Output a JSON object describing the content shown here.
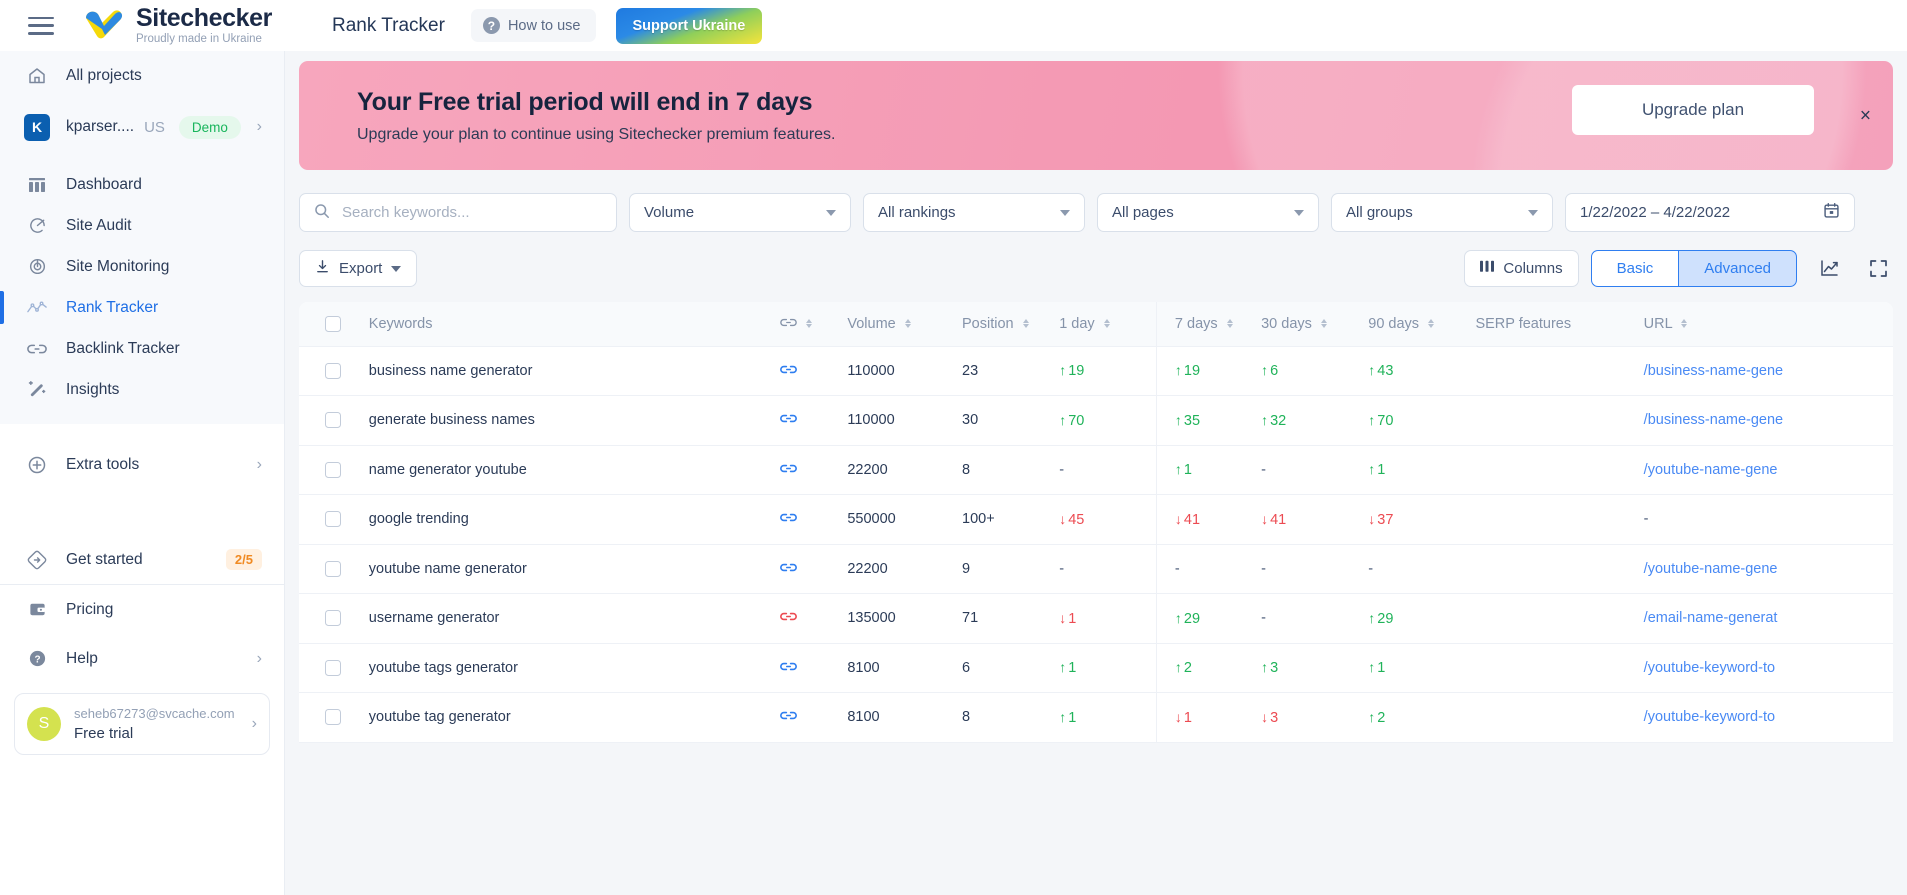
{
  "topbar": {
    "menu_icon": "hamburger-icon",
    "brand_name": "Sitechecker",
    "brand_tagline": "Proudly made in Ukraine",
    "page_title": "Rank Tracker",
    "how_to_use": "How to use",
    "support_button": "Support Ukraine"
  },
  "sidebar": {
    "all_projects": "All projects",
    "project": {
      "initial": "K",
      "name": "kparser....",
      "country": "US",
      "badge": "Demo"
    },
    "nav": [
      {
        "label": "Dashboard",
        "icon": "dashboard-icon",
        "active": false
      },
      {
        "label": "Site Audit",
        "icon": "gauge-icon",
        "active": false
      },
      {
        "label": "Site Monitoring",
        "icon": "radar-icon",
        "active": false
      },
      {
        "label": "Rank Tracker",
        "icon": "trend-icon",
        "active": true
      },
      {
        "label": "Backlink Tracker",
        "icon": "link-icon",
        "active": false
      },
      {
        "label": "Insights",
        "icon": "magic-wand-icon",
        "active": false
      }
    ],
    "extra_tools": "Extra tools",
    "get_started": {
      "label": "Get started",
      "progress": "2/5"
    },
    "pricing": "Pricing",
    "help": "Help",
    "user": {
      "avatar_letter": "S",
      "email": "seheb67273@svcache.com",
      "plan": "Free trial"
    }
  },
  "banner": {
    "title": "Your Free trial period will end in 7 days",
    "subtitle": "Upgrade your plan to continue using Sitechecker premium features.",
    "button": "Upgrade plan",
    "close": "×",
    "bg_color": "#f49ab4"
  },
  "filters": {
    "search_placeholder": "Search keywords...",
    "search_value": "",
    "volume": "Volume",
    "rankings": "All rankings",
    "pages": "All pages",
    "groups": "All groups",
    "date_range": "1/22/2022 – 4/22/2022"
  },
  "toolbar": {
    "export": "Export",
    "columns": "Columns",
    "basic": "Basic",
    "advanced": "Advanced",
    "active_view": "Advanced",
    "chart_icon": "line-chart-icon",
    "fullscreen_icon": "fullscreen-icon"
  },
  "table": {
    "headers": {
      "keywords": "Keywords",
      "link": "link-icon",
      "volume": "Volume",
      "position": "Position",
      "d1": "1 day",
      "d7": "7 days",
      "d30": "30 days",
      "d90": "90 days",
      "serp": "SERP features",
      "url": "URL"
    },
    "rows": [
      {
        "keyword": "business name generator",
        "link_state": "blue",
        "volume": "110000",
        "position": "23",
        "d1": {
          "v": "19",
          "dir": "up"
        },
        "d7": {
          "v": "19",
          "dir": "up"
        },
        "d30": {
          "v": "6",
          "dir": "up"
        },
        "d90": {
          "v": "43",
          "dir": "up"
        },
        "serp": "",
        "url": "/business-name-gene"
      },
      {
        "keyword": "generate business names",
        "link_state": "blue",
        "volume": "110000",
        "position": "30",
        "d1": {
          "v": "70",
          "dir": "up"
        },
        "d7": {
          "v": "35",
          "dir": "up"
        },
        "d30": {
          "v": "32",
          "dir": "up"
        },
        "d90": {
          "v": "70",
          "dir": "up"
        },
        "serp": "",
        "url": "/business-name-gene"
      },
      {
        "keyword": "name generator youtube",
        "link_state": "blue",
        "volume": "22200",
        "position": "8",
        "d1": {
          "v": "-",
          "dir": "none"
        },
        "d7": {
          "v": "1",
          "dir": "up"
        },
        "d30": {
          "v": "-",
          "dir": "none"
        },
        "d90": {
          "v": "1",
          "dir": "up"
        },
        "serp": "",
        "url": "/youtube-name-gene"
      },
      {
        "keyword": "google trending",
        "link_state": "blue",
        "volume": "550000",
        "position": "100+",
        "d1": {
          "v": "45",
          "dir": "down"
        },
        "d7": {
          "v": "41",
          "dir": "down"
        },
        "d30": {
          "v": "41",
          "dir": "down"
        },
        "d90": {
          "v": "37",
          "dir": "down"
        },
        "serp": "",
        "url": "-"
      },
      {
        "keyword": "youtube name generator",
        "link_state": "blue",
        "volume": "22200",
        "position": "9",
        "d1": {
          "v": "-",
          "dir": "none"
        },
        "d7": {
          "v": "-",
          "dir": "none"
        },
        "d30": {
          "v": "-",
          "dir": "none"
        },
        "d90": {
          "v": "-",
          "dir": "none"
        },
        "serp": "",
        "url": "/youtube-name-gene"
      },
      {
        "keyword": "username generator",
        "link_state": "red",
        "volume": "135000",
        "position": "71",
        "d1": {
          "v": "1",
          "dir": "down"
        },
        "d7": {
          "v": "29",
          "dir": "up"
        },
        "d30": {
          "v": "-",
          "dir": "none"
        },
        "d90": {
          "v": "29",
          "dir": "up"
        },
        "serp": "",
        "url": "/email-name-generat"
      },
      {
        "keyword": "youtube tags generator",
        "link_state": "blue",
        "volume": "8100",
        "position": "6",
        "d1": {
          "v": "1",
          "dir": "up"
        },
        "d7": {
          "v": "2",
          "dir": "up"
        },
        "d30": {
          "v": "3",
          "dir": "up"
        },
        "d90": {
          "v": "1",
          "dir": "up"
        },
        "serp": "",
        "url": "/youtube-keyword-to"
      },
      {
        "keyword": "youtube tag generator",
        "link_state": "blue",
        "volume": "8100",
        "position": "8",
        "d1": {
          "v": "1",
          "dir": "up"
        },
        "d7": {
          "v": "1",
          "dir": "down"
        },
        "d30": {
          "v": "3",
          "dir": "down"
        },
        "d90": {
          "v": "2",
          "dir": "up"
        },
        "serp": "",
        "url": "/youtube-keyword-to"
      }
    ]
  },
  "colors": {
    "accent": "#2f7ef0",
    "up": "#20b35a",
    "down": "#ec4b52",
    "banner": "#f49ab4"
  }
}
